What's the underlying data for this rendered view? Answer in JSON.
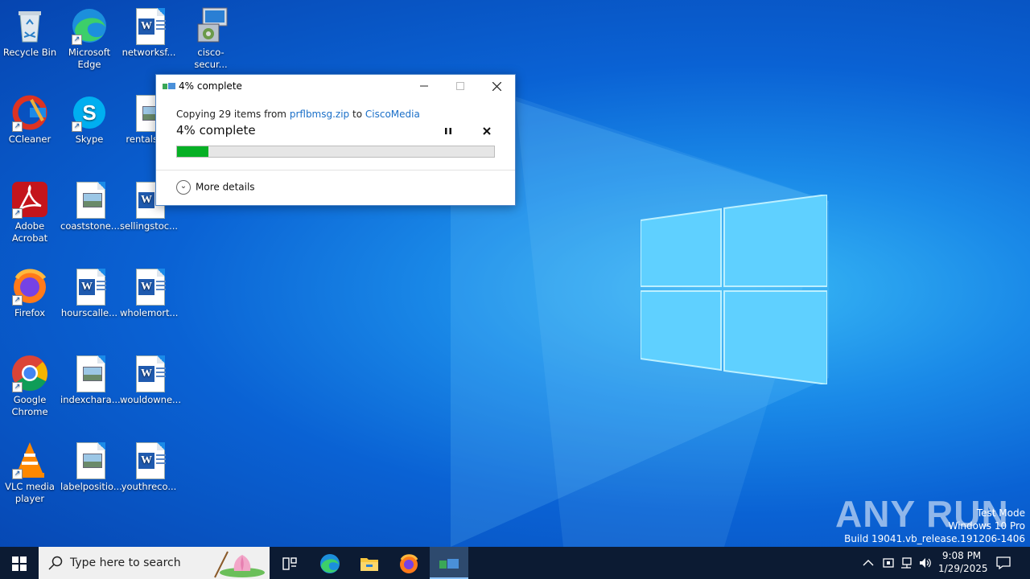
{
  "desktop": {
    "icons": [
      {
        "label": "Recycle Bin"
      },
      {
        "label": "Microsoft Edge"
      },
      {
        "label": "networksf..."
      },
      {
        "label": "cisco-secur..."
      },
      {
        "label": "CCleaner"
      },
      {
        "label": "Skype"
      },
      {
        "label": "rentalsk..."
      },
      {
        "label": "Adobe Acrobat"
      },
      {
        "label": "coaststone...."
      },
      {
        "label": "sellingstoc..."
      },
      {
        "label": "Firefox"
      },
      {
        "label": "hourscalle..."
      },
      {
        "label": "wholemort..."
      },
      {
        "label": "Google Chrome"
      },
      {
        "label": "indexchara..."
      },
      {
        "label": "wouldowne..."
      },
      {
        "label": "VLC media player"
      },
      {
        "label": "labelpositio..."
      },
      {
        "label": "youthreco..."
      }
    ]
  },
  "dialog": {
    "title": "4% complete",
    "copy_prefix": "Copying 29 items from",
    "source": "prflbmsg.zip",
    "to_word": "to",
    "destination": "CiscoMedia",
    "progress_text": "4% complete",
    "progress": 0.1,
    "more_details": "More details"
  },
  "taskbar": {
    "search_placeholder": "Type here to search",
    "time": "9:08 PM",
    "date": "1/29/2025"
  },
  "watermark": {
    "line1": "Test Mode",
    "line2": "Windows 10 Pro",
    "line3": "Build 19041.vb_release.191206-1406",
    "brand": "ANY RUN"
  },
  "colors": {
    "progress_fill": "#06b025",
    "link": "#1a6fc8",
    "taskbar": "#0c1b33"
  }
}
